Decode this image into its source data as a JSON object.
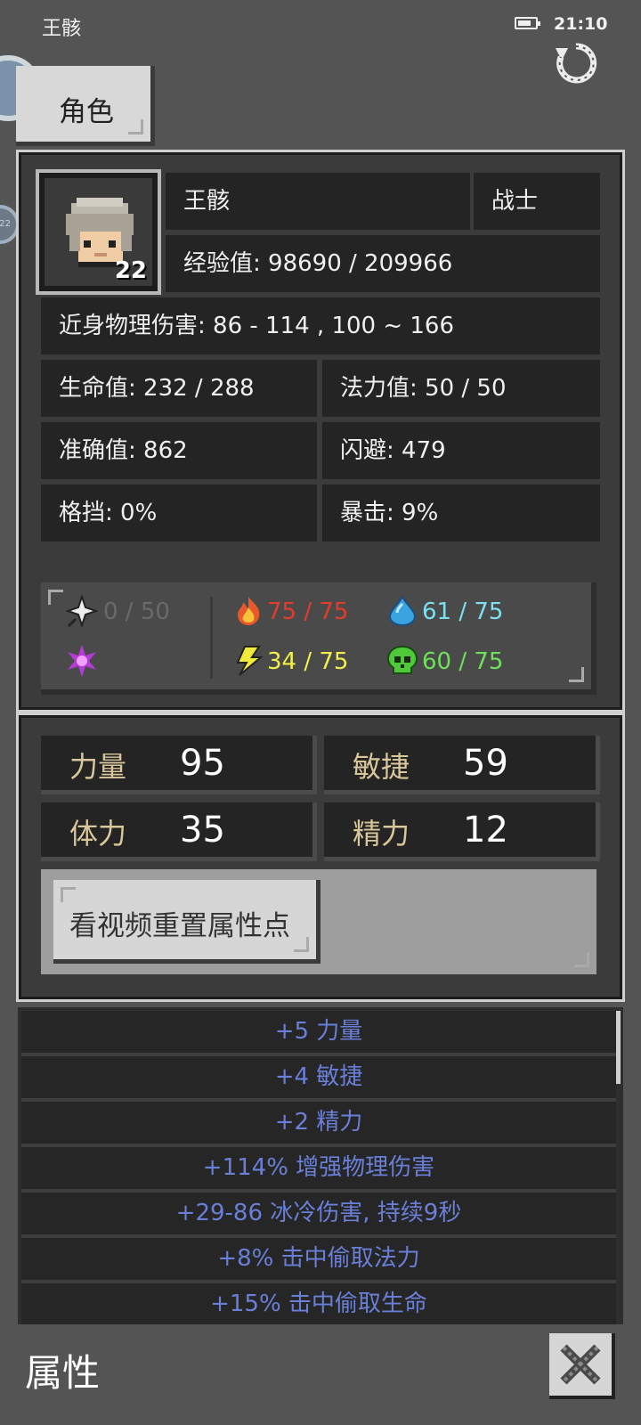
{
  "status_bar": {
    "title": "王骸",
    "time": "21:10",
    "battery_level": 0.7
  },
  "tab": {
    "label": "角色"
  },
  "character": {
    "name": "王骸",
    "class": "战士",
    "level": "22",
    "exp": "经验值: 98690 / 209966",
    "melee": "近身物理伤害: 86 - 114 , 100 ~ 166",
    "hp": "生命值: 232 / 288",
    "mp": "法力值: 50 / 50",
    "accuracy": "准确值: 862",
    "dodge": "闪避: 479",
    "block": "格挡: 0%",
    "crit": "暴击: 9%"
  },
  "resistances": [
    {
      "icon": "shuriken-icon",
      "value": "0 / 50",
      "color": "#6a6a6a"
    },
    {
      "icon": "fire-icon",
      "value": "75 / 75",
      "color": "#e43c2c"
    },
    {
      "icon": "water-drop-icon",
      "value": "61 / 75",
      "color": "#7ce0f0"
    },
    {
      "icon": "arcane-star-icon",
      "value": "",
      "color": "#6a4a6a"
    },
    {
      "icon": "lightning-icon",
      "value": "34 / 75",
      "color": "#f2ee4a"
    },
    {
      "icon": "poison-skull-icon",
      "value": "60 / 75",
      "color": "#6ee05a"
    }
  ],
  "attributes": {
    "strength": {
      "label": "力量",
      "value": "95"
    },
    "agility": {
      "label": "敏捷",
      "value": "59"
    },
    "stamina": {
      "label": "体力",
      "value": "35"
    },
    "energy": {
      "label": "精力",
      "value": "12"
    }
  },
  "reset_button": {
    "label": "看视频重置属性点"
  },
  "bonuses": [
    "+5 力量",
    "+4 敏捷",
    "+2 精力",
    "+114% 增强物理伤害",
    "+29-86 冰冷伤害, 持续9秒",
    "+8% 击中偷取法力",
    "+15% 击中偷取生命"
  ],
  "bottom": {
    "title": "属性"
  },
  "colors": {
    "background": "#545454",
    "attr_label": "#d9c79b",
    "bonus_text": "#6a7fd8"
  }
}
